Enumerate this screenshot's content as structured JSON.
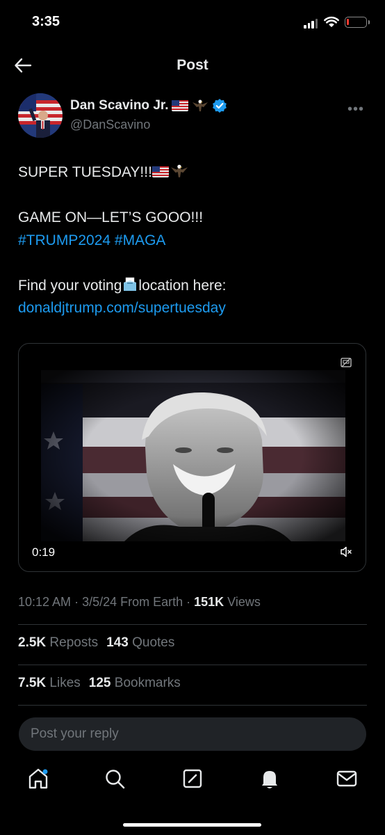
{
  "status_bar": {
    "time": "3:35",
    "battery_level": 0.12
  },
  "header": {
    "title": "Post"
  },
  "post": {
    "author": {
      "display_name": "Dan Scavino Jr.",
      "handle": "@DanScavino",
      "verified": true
    },
    "text": {
      "line1": "SUPER TUESDAY!!!",
      "line2": "GAME ON—LET’S GOOO!!!",
      "hashtag1": "#TRUMP2024",
      "hashtag2": "#MAGA",
      "line4_pre": "Find your voting",
      "line4_post": "location here:",
      "link": "donaldjtrump.com/supertuesday"
    },
    "video": {
      "duration": "0:19",
      "muted": true
    },
    "meta": {
      "time": "10:12 AM",
      "sep1": " · ",
      "date": "3/5/24",
      "location": " From Earth",
      "sep2": " · ",
      "views_count": "151K",
      "views_label": " Views"
    },
    "stats": {
      "reposts_count": "2.5K",
      "reposts_label": "Reposts",
      "quotes_count": "143",
      "quotes_label": "Quotes",
      "likes_count": "7.5K",
      "likes_label": "Likes",
      "bookmarks_count": "125",
      "bookmarks_label": "Bookmarks"
    }
  },
  "reply": {
    "placeholder": "Post your reply"
  },
  "tabs": [
    "home-icon",
    "search-icon",
    "compose-icon",
    "notifications-icon",
    "messages-icon"
  ],
  "colors": {
    "accent": "#1d9bf0",
    "background": "#000000",
    "muted_text": "#71767b",
    "divider": "#2f3336"
  }
}
